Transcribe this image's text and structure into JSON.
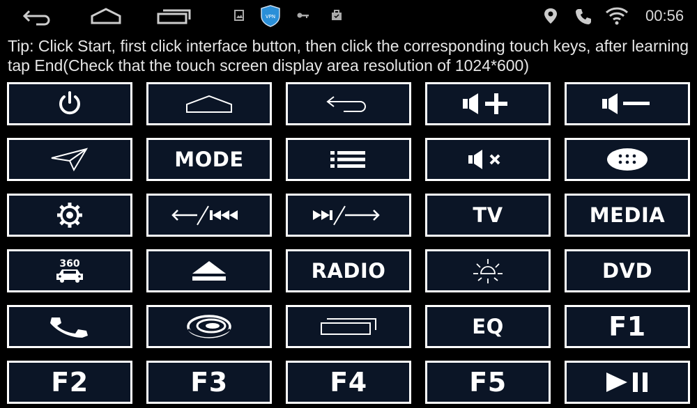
{
  "status_bar": {
    "time": "00:56",
    "nav_icons": [
      "back-icon",
      "home-icon",
      "recent-apps-icon"
    ],
    "notification_icons": [
      "image-icon",
      "vpn-shield-icon",
      "key-icon",
      "briefcase-icon"
    ],
    "status_icons": [
      "location-icon",
      "phone-icon",
      "wifi-icon"
    ],
    "vpn_badge_text": "VPN"
  },
  "tip": "Tip: Click Start, first click interface button, then click the corresponding touch keys, after learning tap End(Check that the touch screen display area resolution of 1024*600)",
  "keys": [
    {
      "name": "power-key",
      "icon": "power-icon",
      "label": ""
    },
    {
      "name": "home-key",
      "icon": "home-outline-icon",
      "label": ""
    },
    {
      "name": "back-key",
      "icon": "back-arrow-icon",
      "label": ""
    },
    {
      "name": "volume-up-key",
      "icon": "volume-up-icon",
      "label": ""
    },
    {
      "name": "volume-down-key",
      "icon": "volume-down-icon",
      "label": ""
    },
    {
      "name": "navigation-key",
      "icon": "navigation-arrow-icon",
      "label": ""
    },
    {
      "name": "mode-key",
      "icon": "",
      "label": "MODE"
    },
    {
      "name": "menu-key",
      "icon": "list-icon",
      "label": ""
    },
    {
      "name": "mute-key",
      "icon": "mute-icon",
      "label": ""
    },
    {
      "name": "apps-key",
      "icon": "app-drawer-icon",
      "label": ""
    },
    {
      "name": "settings-key",
      "icon": "gear-icon",
      "label": ""
    },
    {
      "name": "prev-track-key",
      "icon": "back-prev-track-icon",
      "label": ""
    },
    {
      "name": "next-track-key",
      "icon": "next-track-forward-icon",
      "label": ""
    },
    {
      "name": "tv-key",
      "icon": "",
      "label": "TV"
    },
    {
      "name": "media-key",
      "icon": "",
      "label": "MEDIA"
    },
    {
      "name": "camera-360-key",
      "icon": "car-360-icon",
      "label": "",
      "icon_text": "360"
    },
    {
      "name": "eject-key",
      "icon": "eject-icon",
      "label": ""
    },
    {
      "name": "radio-key",
      "icon": "",
      "label": "RADIO"
    },
    {
      "name": "brightness-key",
      "icon": "brightness-icon",
      "label": ""
    },
    {
      "name": "dvd-key",
      "icon": "",
      "label": "DVD"
    },
    {
      "name": "call-key",
      "icon": "phone-handset-icon",
      "label": ""
    },
    {
      "name": "browser-key",
      "icon": "swirl-logo-icon",
      "label": ""
    },
    {
      "name": "recent-apps-key",
      "icon": "recent-apps-icon",
      "label": ""
    },
    {
      "name": "eq-key",
      "icon": "",
      "label": "EQ"
    },
    {
      "name": "f1-key",
      "icon": "",
      "label": "F1"
    },
    {
      "name": "f2-key",
      "icon": "",
      "label": "F2"
    },
    {
      "name": "f3-key",
      "icon": "",
      "label": "F3"
    },
    {
      "name": "f4-key",
      "icon": "",
      "label": "F4"
    },
    {
      "name": "f5-key",
      "icon": "",
      "label": "F5"
    },
    {
      "name": "play-pause-key",
      "icon": "play-pause-icon",
      "label": ""
    }
  ]
}
